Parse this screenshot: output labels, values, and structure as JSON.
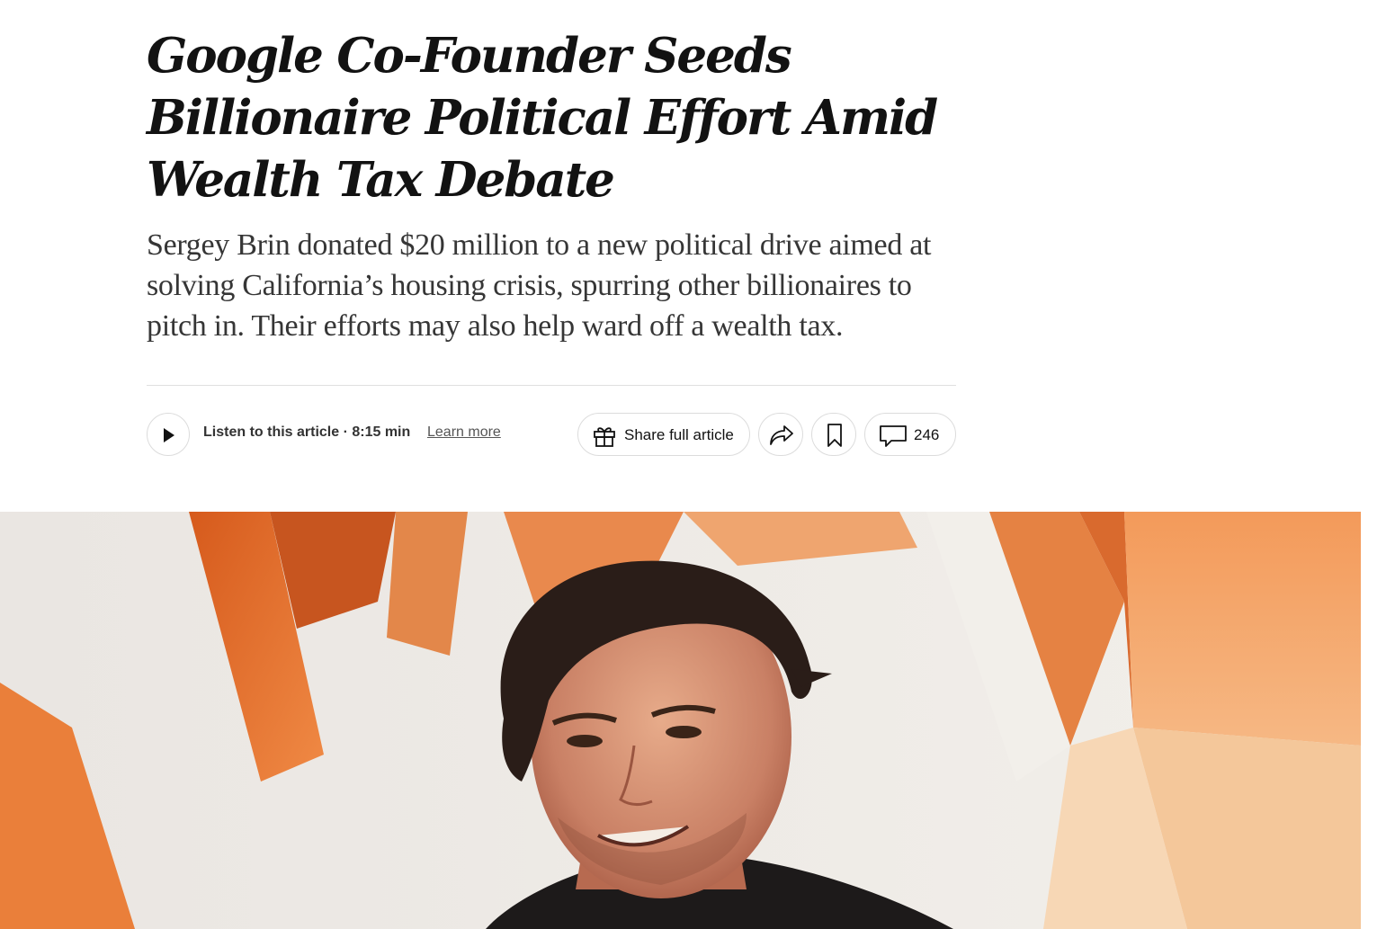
{
  "article": {
    "headline": "Google Co-Founder Seeds Billionaire Political Effort Amid Wealth Tax Debate",
    "summary": "Sergey Brin donated $20 million to a new political drive aimed at solving California’s housing crisis, spurring other billionaires to pitch in. Their efforts may also help ward off a wealth tax."
  },
  "toolbar": {
    "listen_label": "Listen to this article · 8:15 min",
    "learn_more_label": "Learn more",
    "share_full_label": "Share full article",
    "comment_count": "246",
    "icons": {
      "play": "play-icon",
      "gift": "gift-icon",
      "share": "share-arrow-icon",
      "save": "bookmark-icon",
      "comments": "comment-bubble-icon"
    }
  },
  "hero_image": {
    "subject": "smiling man with dark curly hair in front of orange and white backdrop"
  },
  "colors": {
    "text": "#121212",
    "summary_text": "#363636",
    "border": "#dcdcdc",
    "accent_orange": "#e8782f"
  }
}
